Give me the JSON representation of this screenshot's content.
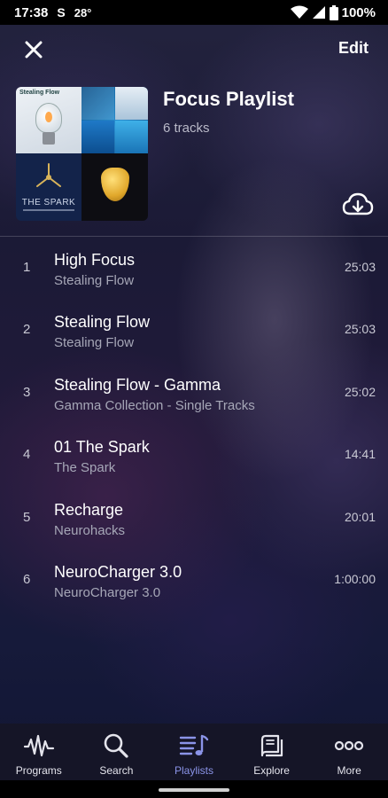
{
  "status_bar": {
    "time": "17:38",
    "carrier_glyph": "S",
    "temperature": "28°",
    "battery": "100%"
  },
  "header": {
    "close_icon": "close-icon",
    "edit_label": "Edit"
  },
  "playlist": {
    "title": "Focus Playlist",
    "track_count": "6 tracks",
    "artwork_caption": "Stealing Flow",
    "artwork_spark_title": "THE SPARK"
  },
  "tracks": [
    {
      "number": "1",
      "title": "High Focus",
      "artist": "Stealing Flow",
      "duration": "25:03"
    },
    {
      "number": "2",
      "title": "Stealing Flow",
      "artist": "Stealing Flow",
      "duration": "25:03"
    },
    {
      "number": "3",
      "title": "Stealing Flow - Gamma",
      "artist": "Gamma Collection - Single Tracks",
      "duration": "25:02"
    },
    {
      "number": "4",
      "title": "01 The Spark",
      "artist": "The Spark",
      "duration": "14:41"
    },
    {
      "number": "5",
      "title": "Recharge",
      "artist": "Neurohacks",
      "duration": "20:01"
    },
    {
      "number": "6",
      "title": "NeuroCharger 3.0",
      "artist": "NeuroCharger 3.0",
      "duration": "1:00:00"
    }
  ],
  "bottom_nav": {
    "items": [
      {
        "label": "Programs",
        "icon": "waveform-icon"
      },
      {
        "label": "Search",
        "icon": "search-icon"
      },
      {
        "label": "Playlists",
        "icon": "playlist-icon",
        "active": true
      },
      {
        "label": "Explore",
        "icon": "books-icon"
      },
      {
        "label": "More",
        "icon": "more-icon"
      }
    ]
  },
  "colors": {
    "active_nav": "#8b94e8",
    "text_primary": "#ffffff",
    "text_secondary": "#a6a7b7"
  }
}
